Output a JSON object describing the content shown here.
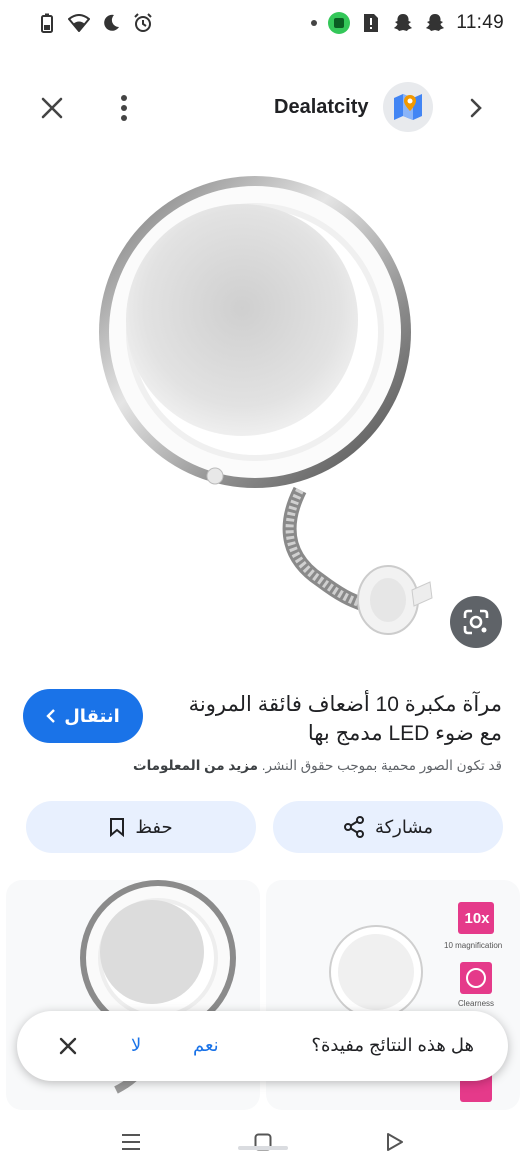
{
  "status_bar": {
    "time": "11:49",
    "icons": [
      "battery-icon",
      "wifi-icon",
      "do-not-disturb-moon-icon",
      "alarm-icon",
      "notification-dot-icon",
      "app-green-badge-icon",
      "sim-alert-icon",
      "snapchat-icon",
      "snapchat-icon"
    ]
  },
  "top_bar": {
    "source_name": "Dealatcity",
    "icons": [
      "close-icon",
      "more-vert-icon",
      "site-favicon-icon",
      "chevron-right-icon"
    ]
  },
  "main_image": {
    "subject": "magnifying mirror with flexible neck and suction base",
    "lens_icon": "google-lens-icon"
  },
  "result": {
    "visit_label": "انتقال",
    "title": "مرآة مكبرة 10 أضعاف فائقة المرونة مع ضوء LED مدمج بها",
    "copyright_notice": "قد تكون الصور محمية بموجب حقوق النشر.",
    "more_info_label": "مزيد من المعلومات"
  },
  "actions": {
    "share_label": "مشاركة",
    "save_label": "حفظ"
  },
  "related": {
    "right_card_badge": "10x",
    "right_card_caption_1": "10 magnification",
    "right_card_caption_2": "Clearness"
  },
  "feedback": {
    "question": "هل هذه النتائج مفيدة؟",
    "yes_label": "نعم",
    "no_label": "لا"
  },
  "nav_bar": {
    "icons": [
      "recents-icon",
      "home-icon",
      "back-icon"
    ]
  },
  "colors": {
    "accent": "#1a73e8",
    "button_tint": "#e8f0fe",
    "lens_button": "#5f6368"
  }
}
